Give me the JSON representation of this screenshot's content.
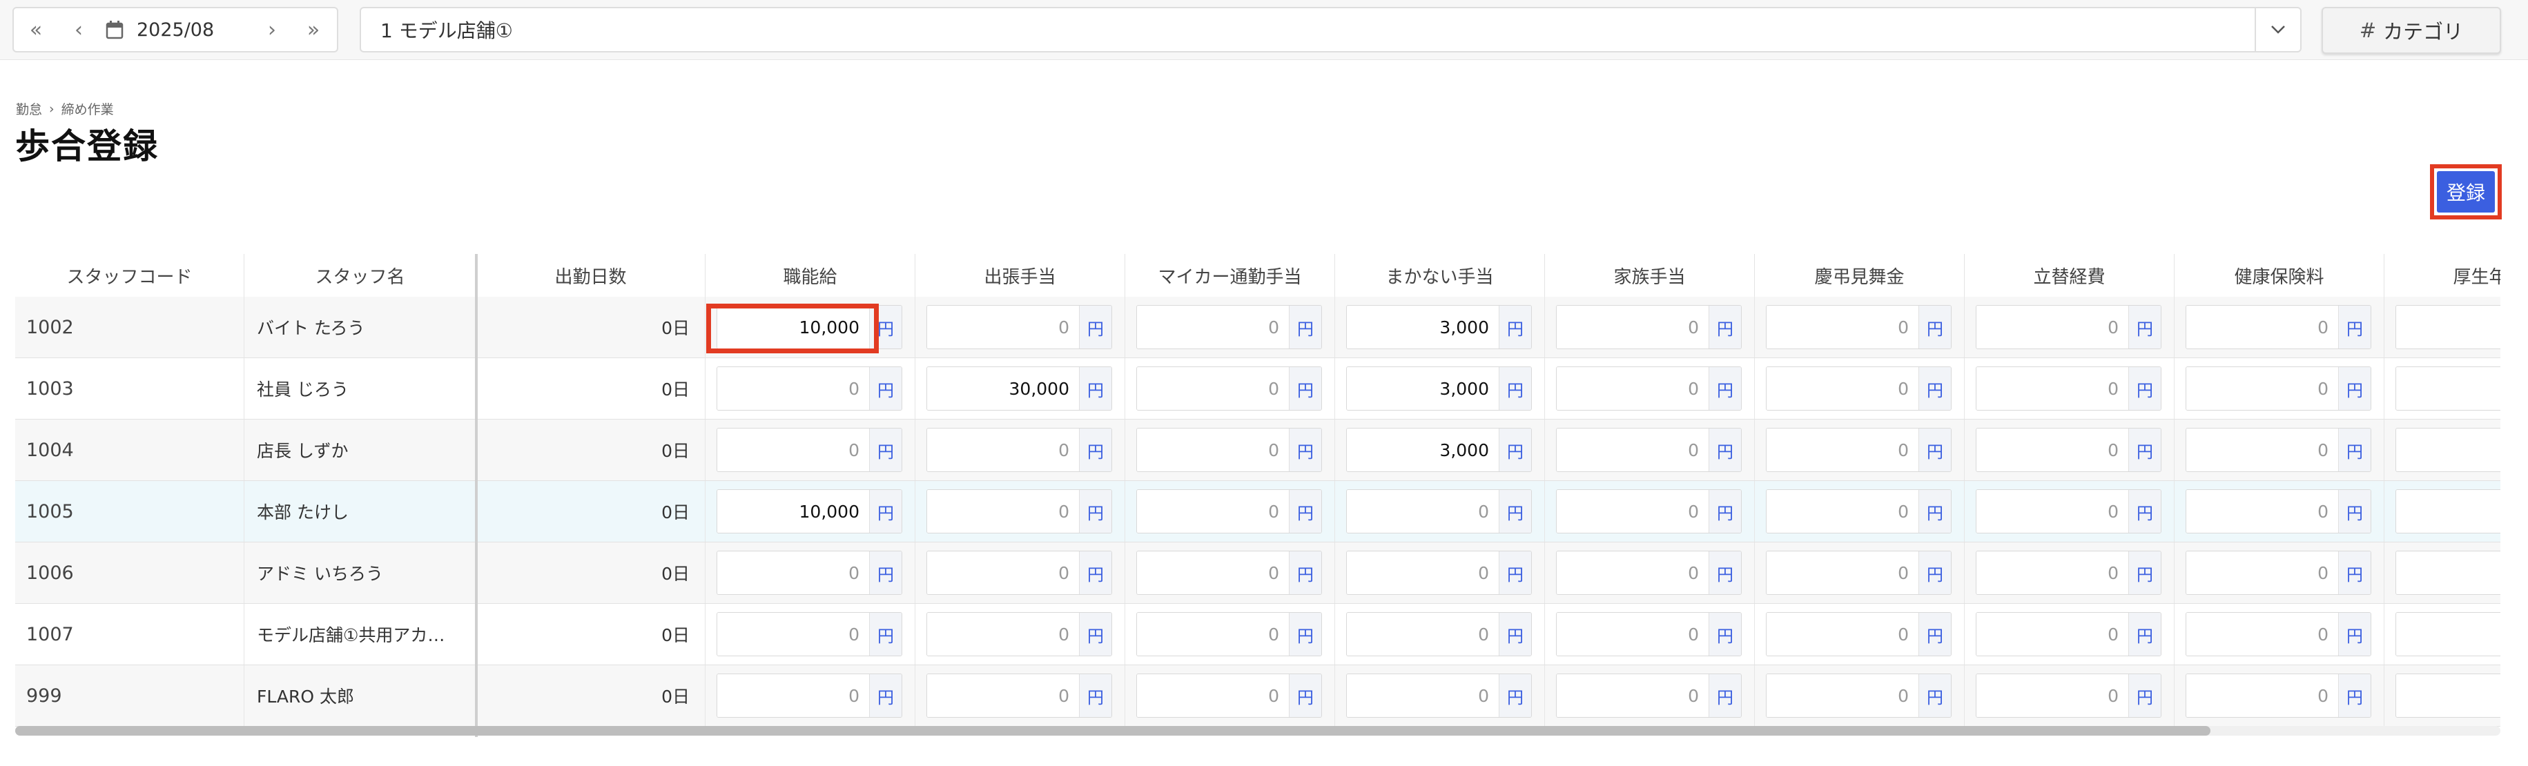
{
  "topbar": {
    "date": "2025/08",
    "store": "1 モデル店舗①",
    "category_label": "カテゴリ",
    "category_icon": "#"
  },
  "breadcrumb": [
    "勤怠",
    "締め作業"
  ],
  "breadcrumb_separator": "›",
  "page_title": "歩合登録",
  "register_label": "登録",
  "columns": [
    "スタッフコード",
    "スタッフ名",
    "出勤日数",
    "職能給",
    "出張手当",
    "マイカー通勤手当",
    "まかない手当",
    "家族手当",
    "慶弔見舞金",
    "立替経費",
    "健康保険料",
    "厚生年金"
  ],
  "unit": "円",
  "rows": [
    {
      "code": "1002",
      "name": "バイト たろう",
      "days": "0日",
      "values": [
        "10,000",
        "0",
        "0",
        "3,000",
        "0",
        "0",
        "0",
        "0"
      ]
    },
    {
      "code": "1003",
      "name": "社員 じろう",
      "days": "0日",
      "values": [
        "0",
        "30,000",
        "0",
        "3,000",
        "0",
        "0",
        "0",
        "0"
      ]
    },
    {
      "code": "1004",
      "name": "店長 しずか",
      "days": "0日",
      "values": [
        "0",
        "0",
        "0",
        "3,000",
        "0",
        "0",
        "0",
        "0"
      ]
    },
    {
      "code": "1005",
      "name": "本部 たけし",
      "days": "0日",
      "values": [
        "10,000",
        "0",
        "0",
        "0",
        "0",
        "0",
        "0",
        "0"
      ]
    },
    {
      "code": "1006",
      "name": "アドミ いちろう",
      "days": "0日",
      "values": [
        "0",
        "0",
        "0",
        "0",
        "0",
        "0",
        "0",
        "0"
      ]
    },
    {
      "code": "1007",
      "name": "モデル店舗①共用アカ…",
      "days": "0日",
      "values": [
        "0",
        "0",
        "0",
        "0",
        "0",
        "0",
        "0",
        "0"
      ]
    },
    {
      "code": "999",
      "name": "FLARO 太郎",
      "days": "0日",
      "values": [
        "0",
        "0",
        "0",
        "0",
        "0",
        "0",
        "0",
        "0"
      ]
    }
  ],
  "colors": {
    "accent": "#3b5fe0",
    "highlight": "#e23b22"
  }
}
